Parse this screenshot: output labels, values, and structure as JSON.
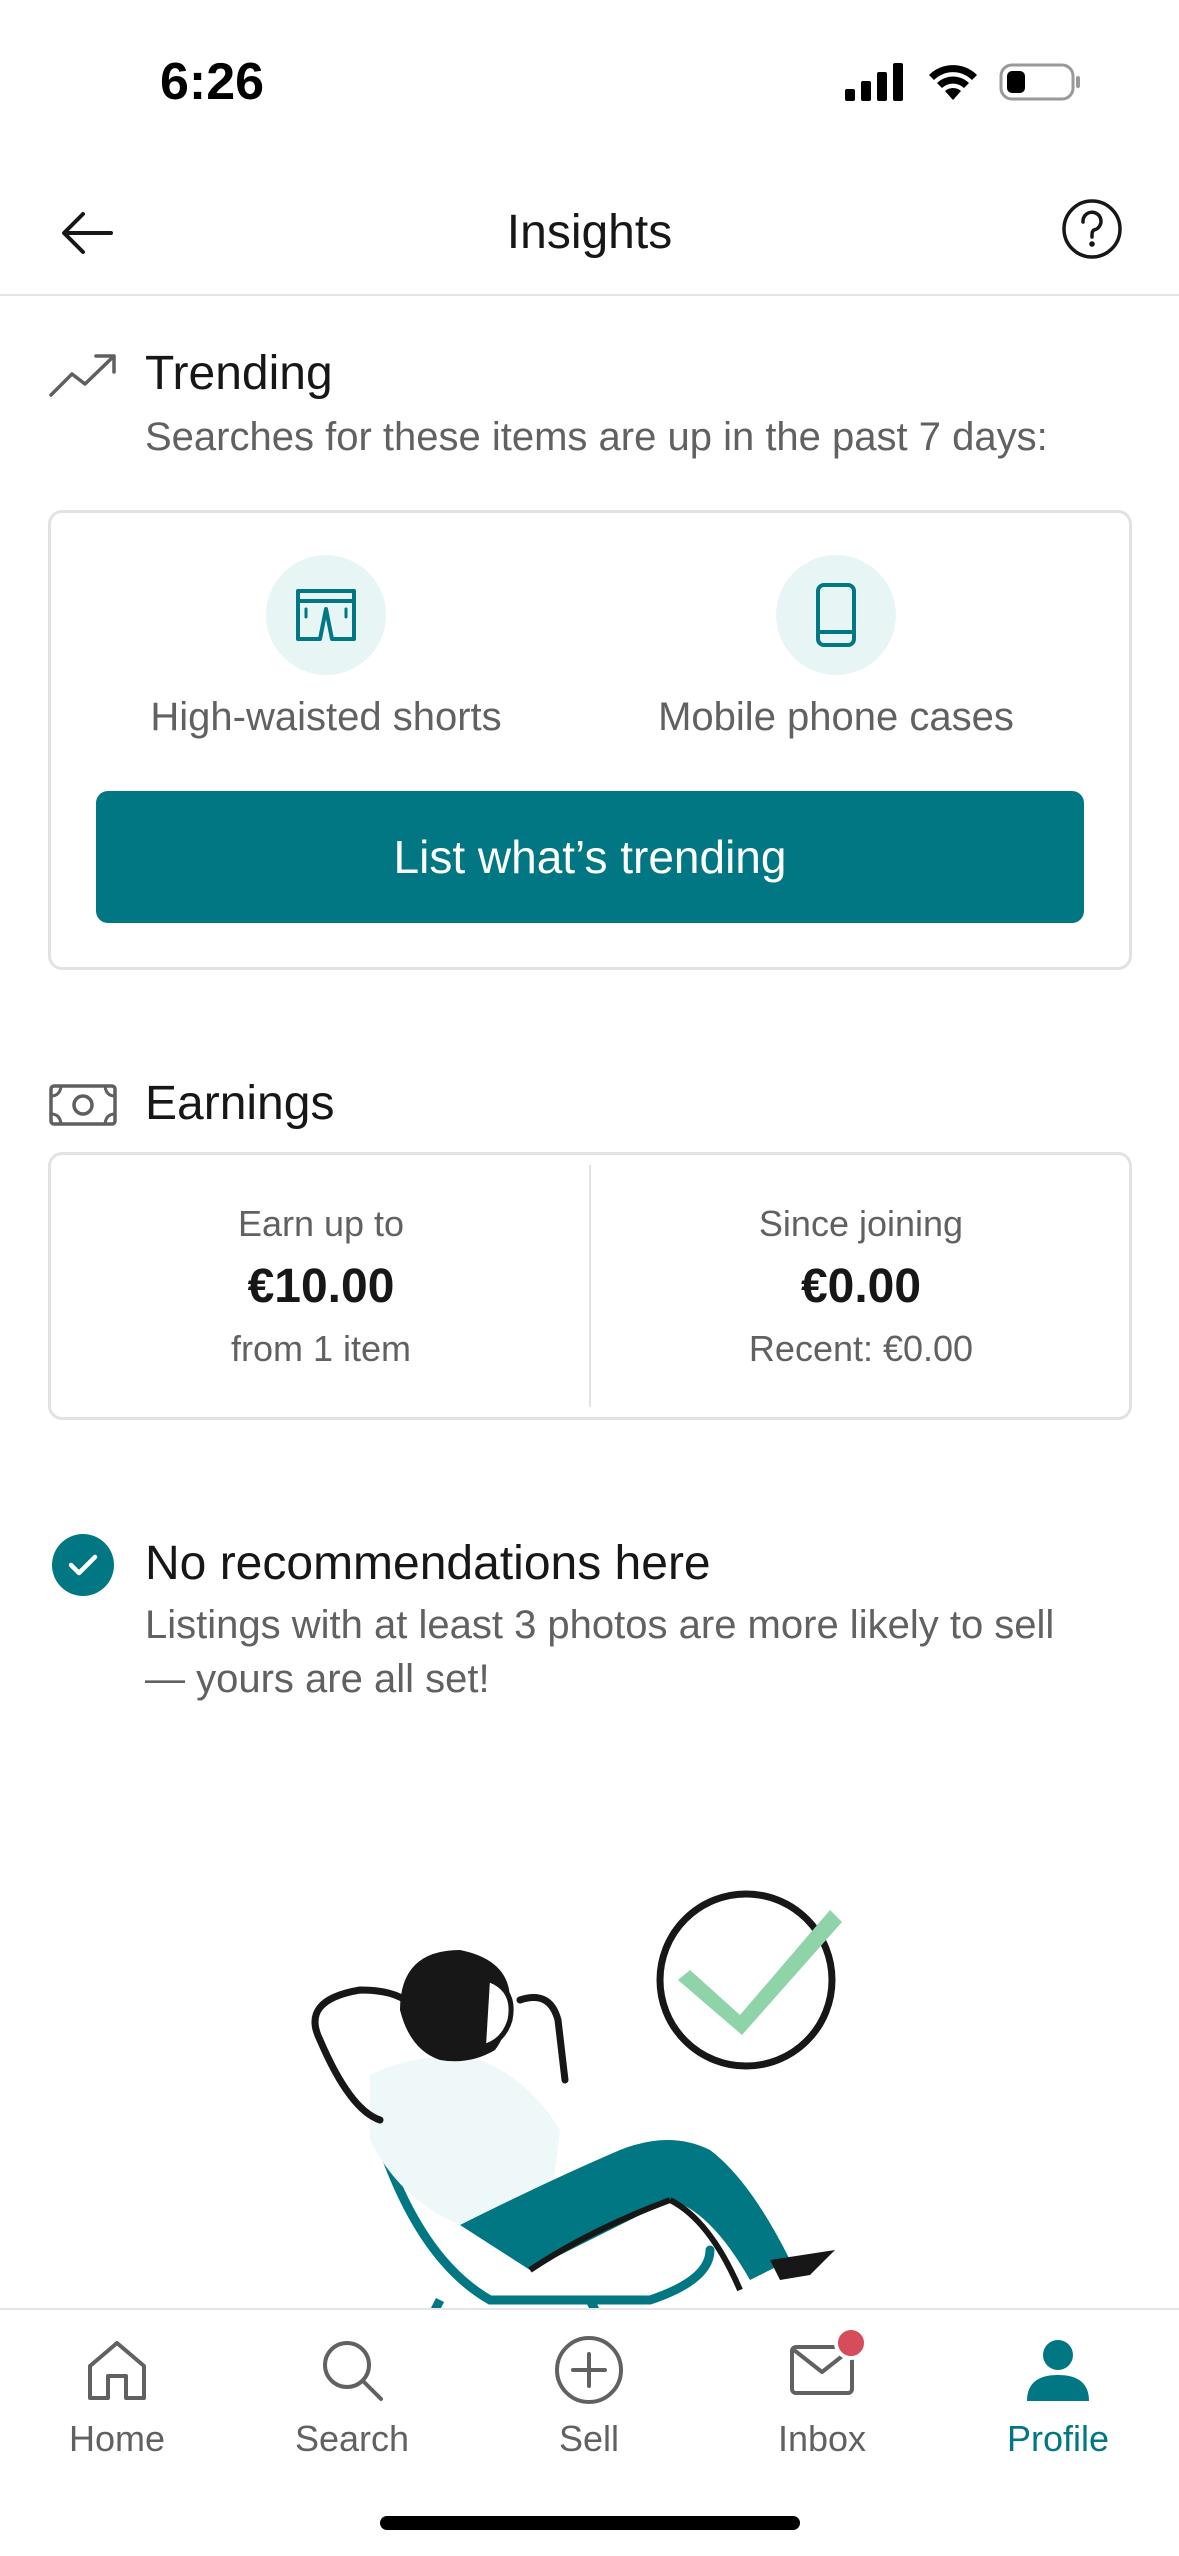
{
  "status_bar": {
    "time": "6:26"
  },
  "header": {
    "title": "Insights"
  },
  "trending": {
    "title": "Trending",
    "subtitle": "Searches for these items are up in the past 7 days:",
    "items": [
      {
        "label": "High-waisted shorts",
        "icon": "shorts-icon"
      },
      {
        "label": "Mobile phone cases",
        "icon": "phone-icon"
      }
    ],
    "cta_label": "List what’s trending"
  },
  "earnings": {
    "title": "Earnings",
    "left": {
      "label": "Earn up to",
      "value": "€10.00",
      "foot": "from 1 item"
    },
    "right": {
      "label": "Since joining",
      "value": "€0.00",
      "foot": "Recent: €0.00"
    }
  },
  "recommendations": {
    "title": "No recommendations here",
    "body": "Listings with at least 3 photos are more likely to sell — yours are all set!"
  },
  "tabs": [
    {
      "label": "Home",
      "icon": "home-icon",
      "active": false
    },
    {
      "label": "Search",
      "icon": "search-icon",
      "active": false
    },
    {
      "label": "Sell",
      "icon": "plus-circle-icon",
      "active": false
    },
    {
      "label": "Inbox",
      "icon": "mail-icon",
      "active": false,
      "badge": true
    },
    {
      "label": "Profile",
      "icon": "person-icon",
      "active": true
    }
  ],
  "colors": {
    "accent": "#007782",
    "accent_light": "#e7f6f5",
    "badge": "#d64c5a",
    "muted_text": "#616161"
  }
}
